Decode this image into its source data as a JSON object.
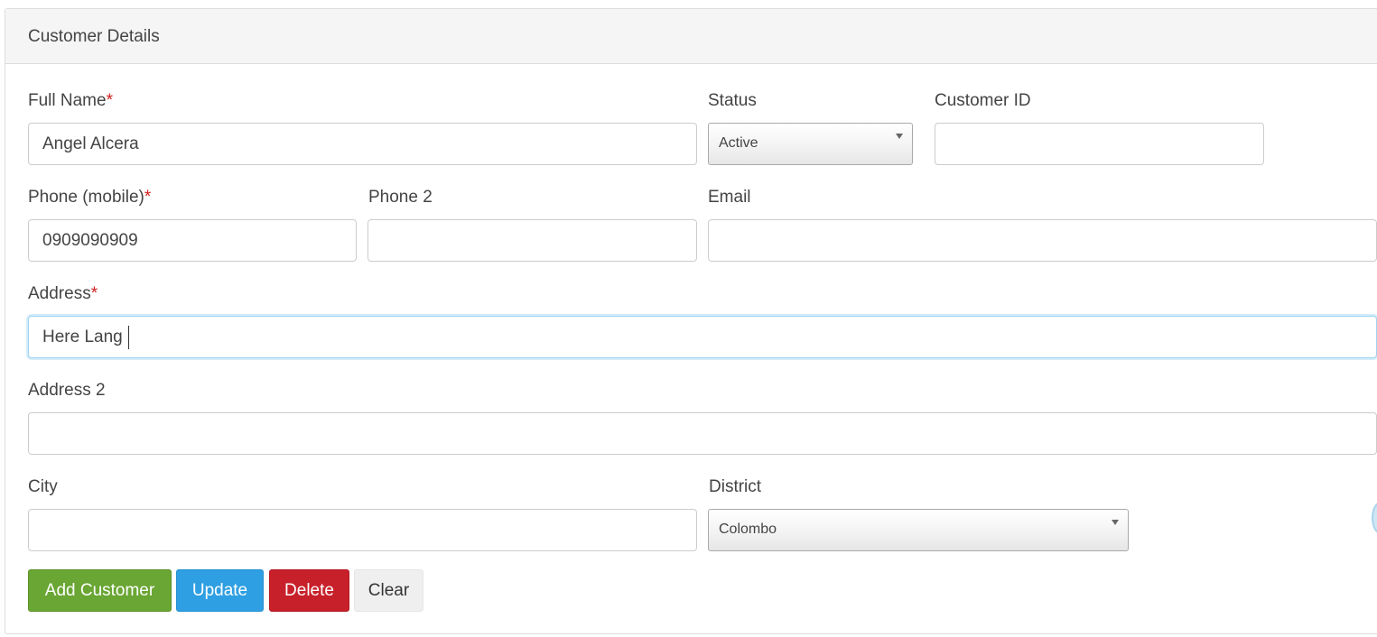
{
  "panel": {
    "title": "Customer Details"
  },
  "form": {
    "full_name": {
      "label": "Full Name",
      "required_mark": "*",
      "value": "Angel Alcera"
    },
    "status": {
      "label": "Status",
      "selected": "Active"
    },
    "customer_id": {
      "label": "Customer ID",
      "value": ""
    },
    "phone_mobile": {
      "label": "Phone (mobile)",
      "required_mark": "*",
      "value": "0909090909"
    },
    "phone2": {
      "label": "Phone 2",
      "value": ""
    },
    "email": {
      "label": "Email",
      "value": ""
    },
    "address": {
      "label": "Address",
      "required_mark": "*",
      "value": "Here Lang "
    },
    "address2": {
      "label": "Address 2",
      "value": ""
    },
    "city": {
      "label": "City",
      "value": ""
    },
    "district": {
      "label": "District",
      "selected": "Colombo"
    }
  },
  "buttons": {
    "add": "Add Customer",
    "update": "Update",
    "delete": "Delete",
    "clear": "Clear"
  },
  "colors": {
    "add_button": "#6aa633",
    "update_button": "#2e9fe2",
    "delete_button": "#c8202a",
    "clear_button": "#efefef",
    "required_mark": "#d11d1d",
    "focus_border": "#9fd3f0"
  },
  "icons": [
    "chevron-down-icon"
  ]
}
